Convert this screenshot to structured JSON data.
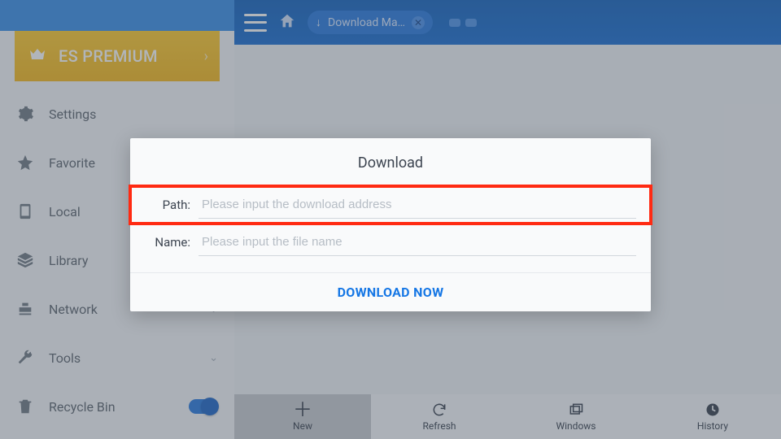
{
  "topbar": {
    "tab_label": "Download Ma…"
  },
  "premium": {
    "label": "ES PREMIUM"
  },
  "sidebar": {
    "items": [
      {
        "label": "Settings"
      },
      {
        "label": "Favorite"
      },
      {
        "label": "Local"
      },
      {
        "label": "Library"
      },
      {
        "label": "Network"
      },
      {
        "label": "Tools"
      },
      {
        "label": "Recycle Bin"
      }
    ]
  },
  "bottombar": {
    "new": "New",
    "refresh": "Refresh",
    "windows": "Windows",
    "history": "History"
  },
  "dialog": {
    "title": "Download",
    "path_label": "Path:",
    "path_placeholder": "Please input the download address",
    "name_label": "Name:",
    "name_placeholder": "Please input the file name",
    "action": "DOWNLOAD NOW"
  }
}
